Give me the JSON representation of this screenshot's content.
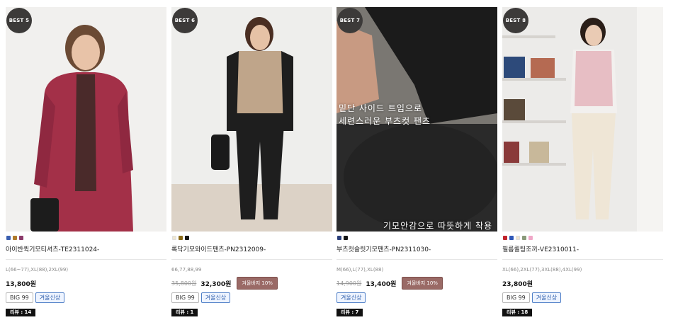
{
  "products": [
    {
      "badge": "BEST 5",
      "swatches": [
        "#3b5fb0",
        "#b07a2a",
        "#8b3a6a"
      ],
      "name": "아이반퀵기모티셔츠-TE2311024-",
      "sizes": "L(66~77),XL(88),2XL(99)",
      "original_price": "",
      "price": "13,800원",
      "discount_label": "",
      "tags": [
        {
          "label": "BIG 99",
          "style": "plain"
        },
        {
          "label": "겨울신상",
          "style": "blue"
        }
      ],
      "review": "리뷰 : 14",
      "overlay": []
    },
    {
      "badge": "BEST 6",
      "swatches": [
        "#efe6cf",
        "#8a6a16",
        "#141414"
      ],
      "name": "록닥기모와이드팬츠-PN2312009-",
      "sizes": "66,77,88,99",
      "original_price": "35,800원",
      "price": "32,300원",
      "discount_label": "겨울바지 10%",
      "tags": [
        {
          "label": "BIG 99",
          "style": "plain"
        },
        {
          "label": "겨울신상",
          "style": "blue"
        }
      ],
      "review": "리뷰 : 1",
      "overlay": []
    },
    {
      "badge": "BEST 7",
      "swatches": [
        "#2b3f7a",
        "#141414"
      ],
      "name": "부츠컷슬릿기모팬츠-PN2311030-",
      "sizes": "M(66),L(77),XL(88)",
      "original_price": "14,900원",
      "price": "13,400원",
      "discount_label": "겨울바지 10%",
      "tags": [
        {
          "label": "겨울신상",
          "style": "blue"
        }
      ],
      "review": "리뷰 : 7",
      "overlay": [
        "밑단 사이드 트임으로",
        "세련스러운 부츠컷 팬츠",
        "기모안감으로 따뜻하게 착용"
      ]
    },
    {
      "badge": "BEST 8",
      "swatches": [
        "#c0242c",
        "#2f58b8",
        "#efe3cf",
        "#8a9a7a",
        "#f0a8c8"
      ],
      "name": "필름퀼팅조끼-VE2310011-",
      "sizes": "XL(66),2XL(77),3XL(88),4XL(99)",
      "original_price": "",
      "price": "23,800원",
      "discount_label": "",
      "tags": [
        {
          "label": "BIG 99",
          "style": "plain"
        },
        {
          "label": "겨울신상",
          "style": "blue"
        }
      ],
      "review": "리뷰 : 18",
      "overlay": []
    }
  ]
}
